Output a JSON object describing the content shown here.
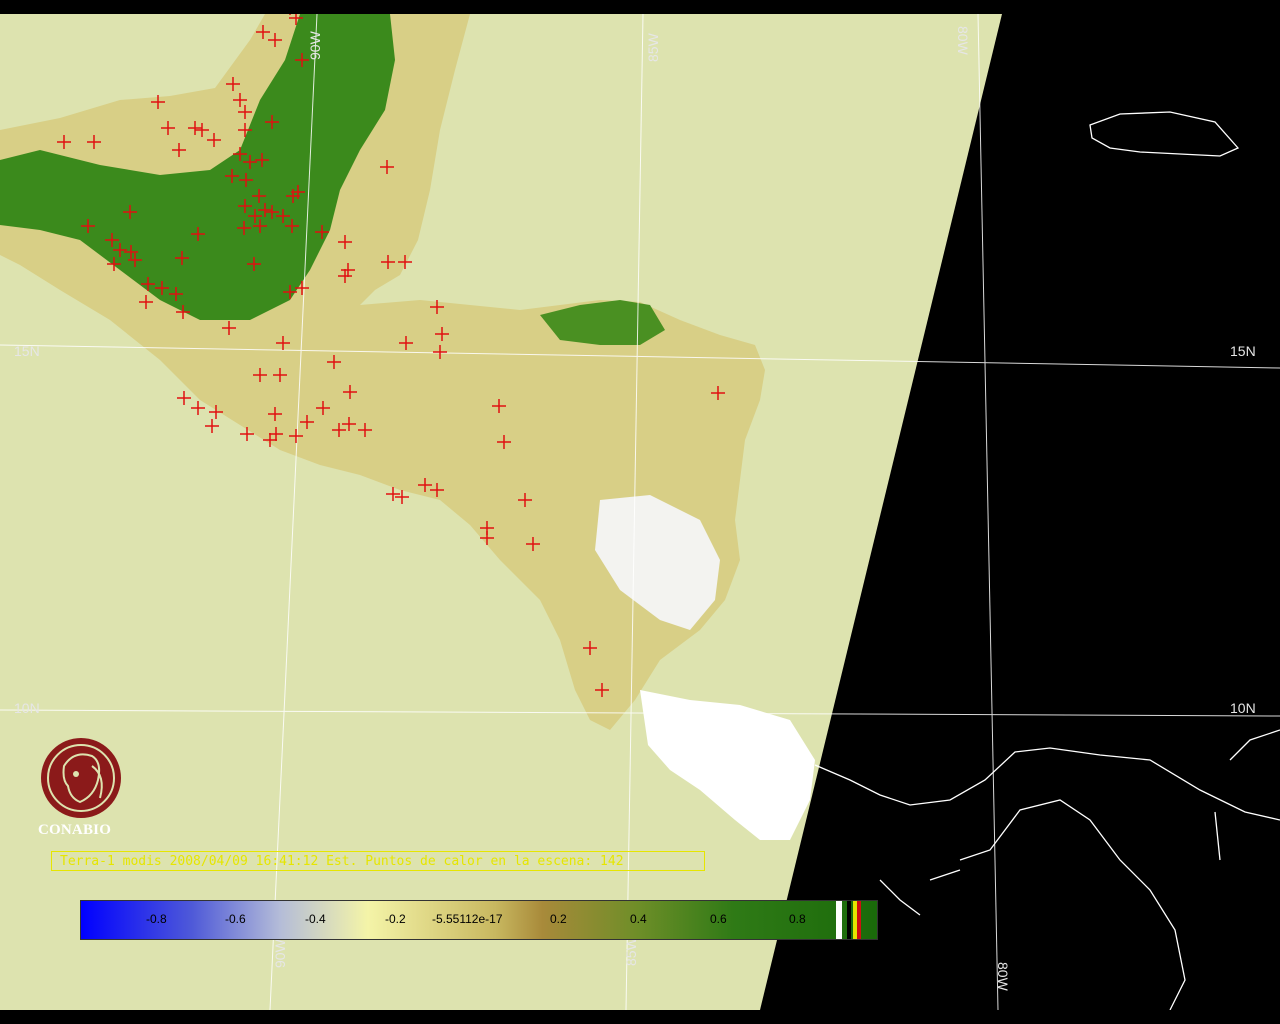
{
  "map": {
    "colors": {
      "background": "#000000",
      "scene": "#dde3af",
      "coastline": "#ffffff",
      "gridline": "#ffffff",
      "fire_marker": "#e01010",
      "vegetation_dark": "#2f7a16",
      "vegetation_light": "#c8b860",
      "cloud": "#ffffff"
    },
    "grid_labels": {
      "top_90w": "90W",
      "top_85w": "85W",
      "top_80w": "80W",
      "left_15n": "15N",
      "right_15n": "15N",
      "left_10n": "10N",
      "right_10n": "10N",
      "bottom_90w": "90W",
      "bottom_85w": "85W",
      "bottom_80w": "80W"
    },
    "marker_symbol": "red-cross-icon"
  },
  "logo": {
    "icon": "conabio-emblem-icon",
    "text": "CONABIO",
    "color": "#8b1a1a"
  },
  "caption": {
    "text": "Terra-1 modis 2008/04/09 16:41:12 Est. Puntos de calor en la escena: 142"
  },
  "colorbar": {
    "ticks": [
      "-0.8",
      "-0.6",
      "-0.4",
      "-0.2",
      "-5.55112e-17",
      "0.2",
      "0.4",
      "0.6",
      "0.8"
    ],
    "extra_colors": [
      "#ffffff",
      "#000000",
      "#e6e600",
      "#d01010"
    ]
  }
}
